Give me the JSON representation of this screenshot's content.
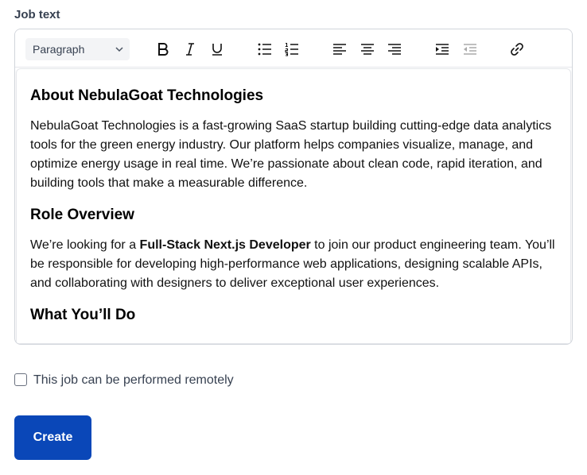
{
  "field": {
    "label": "Job text"
  },
  "toolbar": {
    "block_type": "Paragraph",
    "buttons": [
      "bold",
      "italic",
      "underline",
      "bullet-list",
      "numbered-list",
      "align-left",
      "align-center",
      "align-right",
      "indent",
      "outdent",
      "link"
    ]
  },
  "content": {
    "about_heading": "About NebulaGoat Technologies",
    "about_text": "NebulaGoat Technologies is a fast-growing SaaS startup building cutting-edge data analytics tools for the green energy industry. Our platform helps companies visualize, manage, and optimize energy usage in real time. We’re passionate about clean code, rapid iteration, and building tools that make a measurable difference.",
    "role_heading": "Role Overview",
    "role_text_before": "We’re looking for a ",
    "role_text_bold": "Full-Stack Next.js Developer",
    "role_text_after": " to join our product engineering team. You’ll be responsible for developing high-performance web applications, designing scalable APIs, and collaborating with designers to deliver exceptional user experiences.",
    "todo_heading": "What You’ll Do"
  },
  "remote": {
    "label": "This job can be performed remotely",
    "checked": false
  },
  "actions": {
    "create_label": "Create"
  },
  "colors": {
    "primary": "#0a47b8",
    "border": "#d1d5db",
    "select_bg": "#f3f4f6"
  }
}
